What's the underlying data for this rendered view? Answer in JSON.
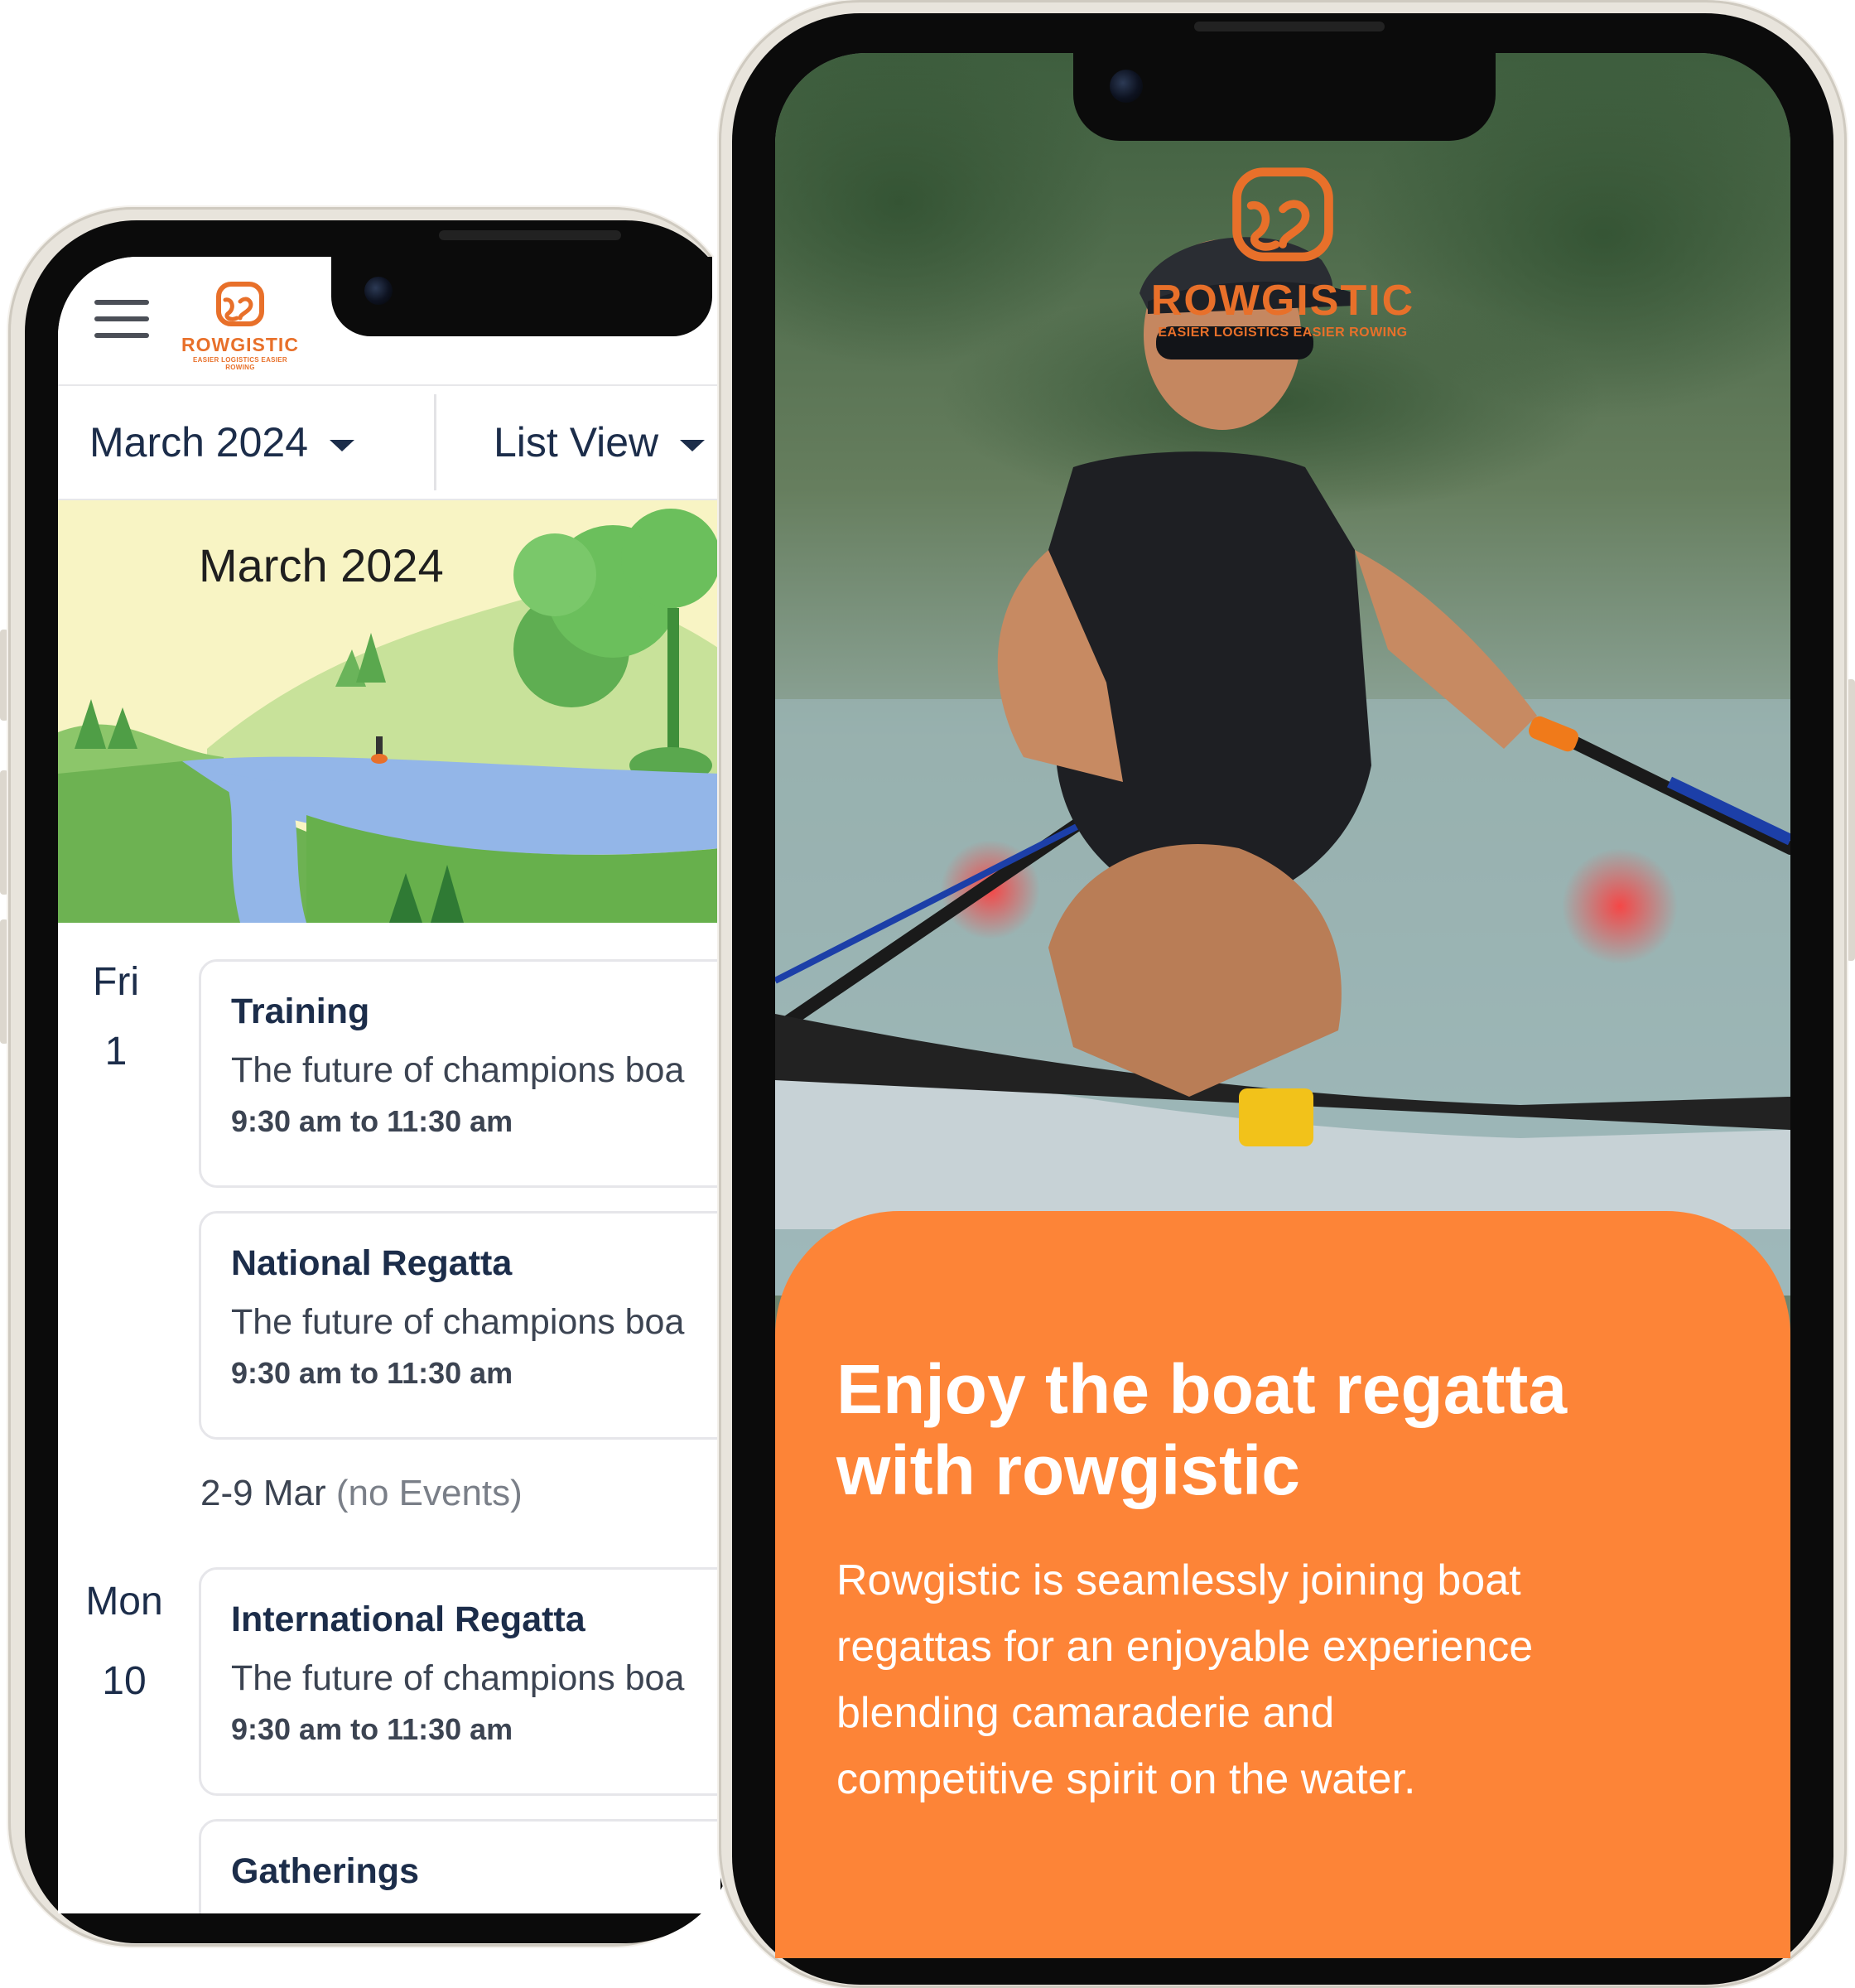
{
  "left_app": {
    "brand_name": "ROWGISTIC",
    "brand_tagline": "EASIER LOGISTICS EASIER ROWING",
    "month_selector": "March 2024",
    "view_selector": "List View",
    "banner_title": "March 2024",
    "groups": [
      {
        "weekday": "Fri",
        "day": "1",
        "events": [
          {
            "title": "Training",
            "description": "The future of champions boa",
            "time": "9:30 am to 11:30 am"
          },
          {
            "title": "National Regatta",
            "description": "The future of champions boa",
            "time": "9:30 am to 11:30 am"
          }
        ]
      },
      {
        "weekday": "Mon",
        "day": "10",
        "events": [
          {
            "title": "International Regatta",
            "description": "The future of champions boa",
            "time": "9:30 am to 11:30 am"
          },
          {
            "title": "Gatherings"
          }
        ]
      }
    ],
    "gap": {
      "range": "2-9 Mar",
      "note": "(no Events)"
    }
  },
  "right_app": {
    "brand_name": "ROWGISTIC",
    "brand_tagline": "EASIER LOGISTICS EASIER ROWING",
    "headline_line1": "Enjoy the boat regatta",
    "headline_line2": "with rowgistic",
    "body_lines": [
      "Rowgistic is seamlessly joining boat",
      "regattas for an enjoyable experience",
      "blending camaraderie and",
      "competitive spirit on the water."
    ]
  },
  "colors": {
    "brand_orange": "#e8702a",
    "card_orange": "#fd8437",
    "navy_text": "#1c2d4a"
  },
  "icons": [
    "menu-icon",
    "caret-down-icon",
    "rowgistic-logo-icon",
    "camera-icon"
  ]
}
